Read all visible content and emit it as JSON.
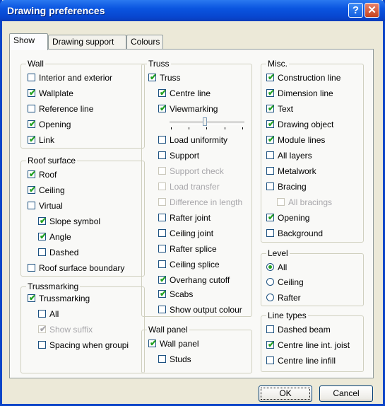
{
  "window": {
    "title": "Drawing preferences",
    "help_label": "?",
    "close_label": "✕"
  },
  "tabs": [
    {
      "label": "Show"
    },
    {
      "label": "Drawing support"
    },
    {
      "label": "Colours"
    }
  ],
  "groups": {
    "wall": {
      "title": "Wall",
      "items": [
        {
          "label": "Interior and exterior",
          "checked": false
        },
        {
          "label": "Wallplate",
          "checked": true
        },
        {
          "label": "Reference line",
          "checked": false
        },
        {
          "label": "Opening",
          "checked": true
        },
        {
          "label": "Link",
          "checked": true
        }
      ]
    },
    "roof_surface": {
      "title": "Roof surface",
      "items": [
        {
          "label": "Roof",
          "checked": true
        },
        {
          "label": "Ceiling",
          "checked": true
        },
        {
          "label": "Virtual",
          "checked": false
        },
        {
          "label": "Slope symbol",
          "checked": true
        },
        {
          "label": "Angle",
          "checked": true
        },
        {
          "label": "Dashed",
          "checked": false
        },
        {
          "label": "Roof surface boundary",
          "checked": false
        }
      ]
    },
    "trussmarking": {
      "title": "Trussmarking",
      "items": [
        {
          "label": "Trussmarking",
          "checked": true
        },
        {
          "label": "All",
          "checked": false
        },
        {
          "label": "Show suffix",
          "checked": true,
          "disabled": true
        },
        {
          "label": "Spacing when groupi",
          "checked": false
        }
      ]
    },
    "truss": {
      "title": "Truss",
      "items": [
        {
          "label": "Truss",
          "checked": true
        },
        {
          "label": "Centre line",
          "checked": true
        },
        {
          "label": "Viewmarking",
          "checked": true
        },
        {
          "label": "Load uniformity",
          "checked": false
        },
        {
          "label": "Support",
          "checked": false
        },
        {
          "label": "Support check",
          "checked": false,
          "disabled": true
        },
        {
          "label": "Load transfer",
          "checked": false,
          "disabled": true
        },
        {
          "label": "Difference in length",
          "checked": false,
          "disabled": true
        },
        {
          "label": "Rafter joint",
          "checked": false
        },
        {
          "label": "Ceiling joint",
          "checked": false
        },
        {
          "label": "Rafter splice",
          "checked": false
        },
        {
          "label": "Ceiling splice",
          "checked": false
        },
        {
          "label": "Overhang cutoff",
          "checked": true
        },
        {
          "label": "Scabs",
          "checked": true
        },
        {
          "label": "Show output colour",
          "checked": false
        }
      ],
      "viewmarking_slider": 0.5
    },
    "wall_panel": {
      "title": "Wall panel",
      "items": [
        {
          "label": "Wall panel",
          "checked": true
        },
        {
          "label": "Studs",
          "checked": false
        }
      ]
    },
    "misc": {
      "title": "Misc.",
      "items": [
        {
          "label": "Construction line",
          "checked": true
        },
        {
          "label": "Dimension line",
          "checked": true
        },
        {
          "label": "Text",
          "checked": true
        },
        {
          "label": "Drawing object",
          "checked": true
        },
        {
          "label": "Module lines",
          "checked": true
        },
        {
          "label": "All layers",
          "checked": false
        },
        {
          "label": "Metalwork",
          "checked": false
        },
        {
          "label": "Bracing",
          "checked": false
        },
        {
          "label": "All bracings",
          "checked": false,
          "disabled": true
        },
        {
          "label": "Opening",
          "checked": true
        },
        {
          "label": "Background",
          "checked": false
        }
      ]
    },
    "level": {
      "title": "Level",
      "options": [
        {
          "label": "All",
          "selected": true
        },
        {
          "label": "Ceiling",
          "selected": false
        },
        {
          "label": "Rafter",
          "selected": false
        }
      ]
    },
    "line_types": {
      "title": "Line types",
      "items": [
        {
          "label": "Dashed beam",
          "checked": false
        },
        {
          "label": "Centre line int. joist",
          "checked": true
        },
        {
          "label": "Centre line infill",
          "checked": false
        }
      ]
    }
  },
  "buttons": {
    "ok": "OK",
    "cancel": "Cancel"
  }
}
